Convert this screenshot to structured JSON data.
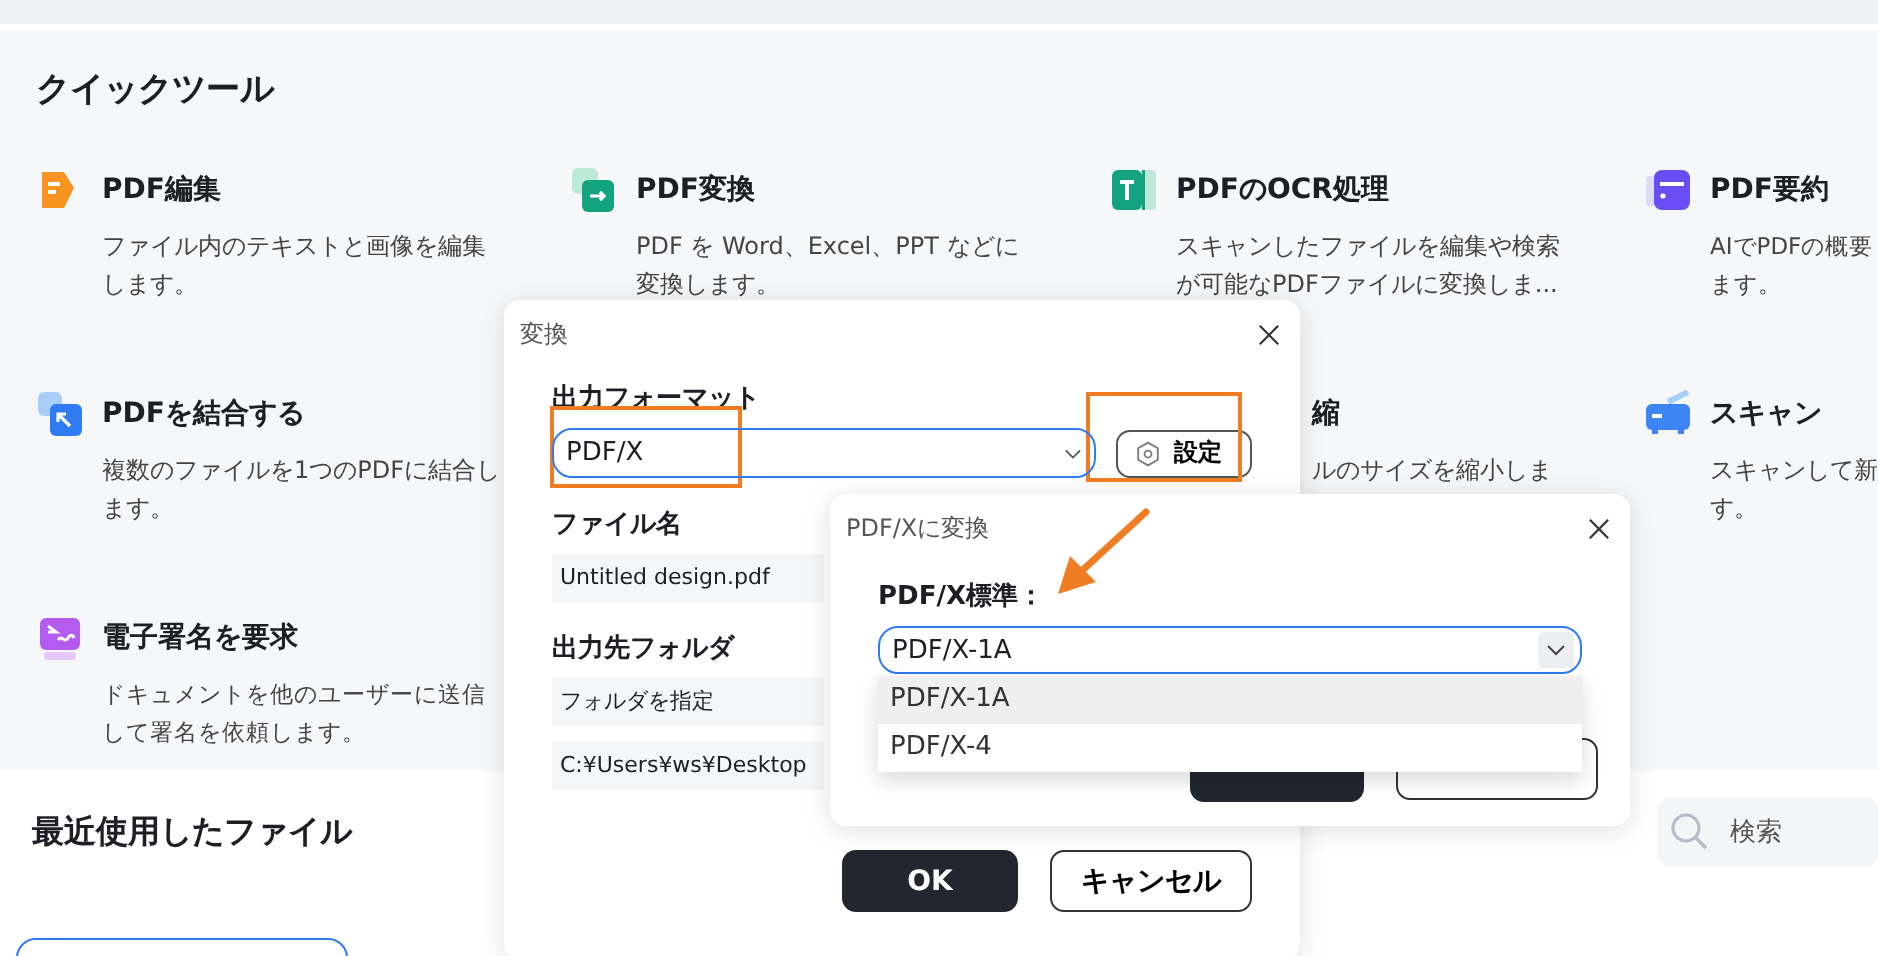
{
  "quick_tools": {
    "title": "クイックツール",
    "tools": [
      {
        "kind": "edit",
        "title": "PDF編集",
        "description": [
          "ファイル内のテキストと画像を編集",
          "します。"
        ]
      },
      {
        "kind": "convert",
        "title": "PDF変換",
        "description": [
          "PDF を Word、Excel、PPT などに",
          "変換します。"
        ]
      },
      {
        "kind": "ocr",
        "title": "PDFのOCR処理",
        "description": [
          "スキャンしたファイルを編集や検索",
          "が可能なPDFファイルに変換しま..."
        ]
      },
      {
        "kind": "summarize",
        "title": "PDF要約",
        "description": [
          "AIでPDFの概要",
          "ます。"
        ]
      },
      {
        "kind": "merge",
        "title": "PDFを結合する",
        "description": [
          "複数のファイルを1つのPDFに結合し",
          "ます。"
        ]
      },
      {
        "kind": "covered",
        "title": "縮",
        "description": [
          "ルのサイズを縮小しま"
        ]
      },
      {
        "kind": "scan",
        "title": "スキャン",
        "description": [
          "スキャンして新",
          "す。"
        ]
      },
      {
        "kind": "sign",
        "title": "電子署名を要求",
        "description": [
          "ドキュメントを他のユーザーに送信",
          "して署名を依頼します。"
        ]
      }
    ]
  },
  "recent": {
    "title": "最近使用したファイル",
    "search": {
      "placeholder": "検索"
    }
  },
  "convert_dialog": {
    "title": "変換",
    "format_label": "出力フォーマット",
    "format_value": "PDF/X",
    "settings_button": "設定",
    "filename_label": "ファイル名",
    "filename": "Untitled design.pdf",
    "folder_label": "出力先フォルダ",
    "folder_choice": "フォルダを指定",
    "folder_path": "C:¥Users¥ws¥Desktop",
    "buttons": [
      "OK",
      "キャンセル"
    ]
  },
  "pdfx_dialog": {
    "title": "PDF/Xに変換",
    "standard_label": "PDF/X標準：",
    "value": "PDF/X-1A",
    "options": [
      {
        "label": "PDF/X-1A",
        "selected": true
      },
      {
        "label": "PDF/X-4",
        "selected": false
      }
    ]
  }
}
